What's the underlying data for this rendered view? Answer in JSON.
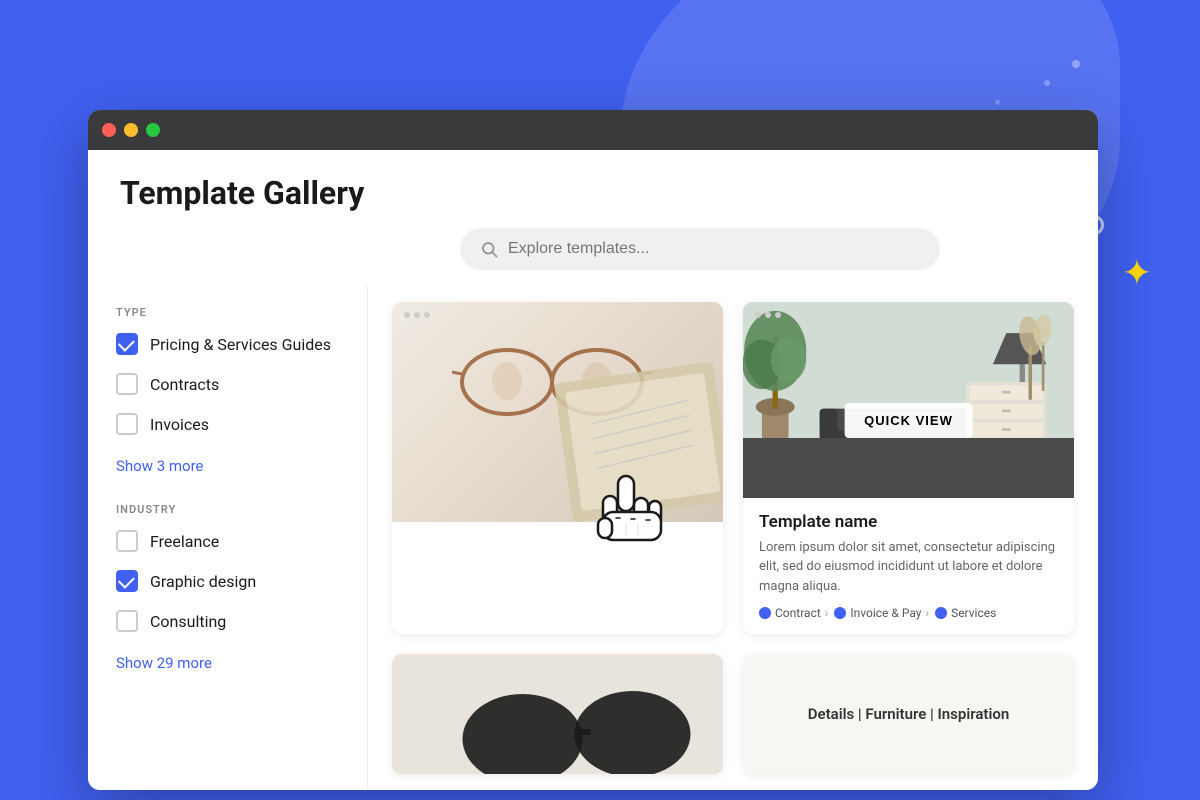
{
  "page": {
    "title": "Template Gallery"
  },
  "search": {
    "placeholder": "Explore templates..."
  },
  "sidebar": {
    "type_label": "TYPE",
    "industry_label": "INDUSTRY",
    "type_filters": [
      {
        "label": "Pricing & Services Guides",
        "checked": true
      },
      {
        "label": "Contracts",
        "checked": false
      },
      {
        "label": "Invoices",
        "checked": false
      }
    ],
    "type_show_more": "Show 3 more",
    "industry_filters": [
      {
        "label": "Freelance",
        "checked": false
      },
      {
        "label": "Graphic design",
        "checked": true
      },
      {
        "label": "Consulting",
        "checked": false
      }
    ],
    "industry_show_more": "Show 29 more"
  },
  "gallery": {
    "cards": [
      {
        "id": 1,
        "title": "",
        "description": "",
        "tags": []
      },
      {
        "id": 2,
        "title": "Template name",
        "description": "Lorem ipsum dolor sit amet, consectetur adipiscing elit, sed do eiusmod incididunt ut labore et dolore magna aliqua.",
        "tags": [
          "Contract",
          "Invoice & Pay",
          "Services"
        ],
        "quick_view_label": "QUICK VIEW"
      }
    ]
  },
  "bottom_cards": {
    "card4_text": "Details | Furniture | Inspiration"
  }
}
